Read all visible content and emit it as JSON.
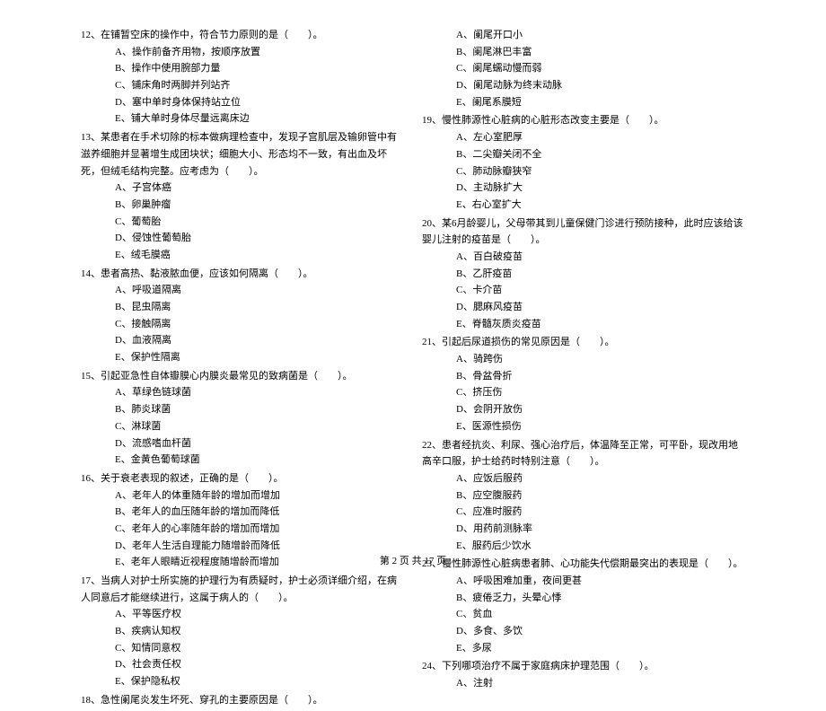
{
  "left": {
    "q12": {
      "title": "12、在铺暂空床的操作中，符合节力原则的是（　　）。",
      "a": "A、操作前备齐用物，按顺序放置",
      "b": "B、操作中使用腕部力量",
      "c": "C、铺床角时两脚并列站齐",
      "d": "D、塞中单时身体保持站立位",
      "e": "E、铺大单时身体尽量远离床边"
    },
    "q13": {
      "title": "13、某患者在手术切除的标本做病理检查中，发现子宫肌层及输卵管中有滋养细胞并显著增生成团块状；细胞大小、形态均不一致，有出血及坏死，但绒毛结构完整。应考虑为（　　）。",
      "a": "A、子宫体癌",
      "b": "B、卵巢肿瘤",
      "c": "C、葡萄胎",
      "d": "D、侵蚀性葡萄胎",
      "e": "E、绒毛膜癌"
    },
    "q14": {
      "title": "14、患者高热、黏液脓血便，应该如何隔离（　　）。",
      "a": "A、呼吸道隔离",
      "b": "B、昆虫隔离",
      "c": "C、接触隔离",
      "d": "D、血液隔离",
      "e": "E、保护性隔离"
    },
    "q15": {
      "title": "15、引起亚急性自体瓣膜心内膜炎最常见的致病菌是（　　）。",
      "a": "A、草绿色链球菌",
      "b": "B、肺炎球菌",
      "c": "C、淋球菌",
      "d": "D、流感嗜血杆菌",
      "e": "E、金黄色葡萄球菌"
    },
    "q16": {
      "title": "16、关于衰老表现的叙述，正确的是（　　）。",
      "a": "A、老年人的体重随年龄的增加而增加",
      "b": "B、老年人的血压随年龄的增加而降低",
      "c": "C、老年人的心率随年龄的增加而增加",
      "d": "D、老年人生活自理能力随增龄而降低",
      "e": "E、老年人眼睛近视程度随增龄而增加"
    },
    "q17": {
      "title": "17、当病人对护士所实施的护理行为有质疑时，护士必须详细介绍，在病人同意后才能继续进行，这属于病人的（　　）。",
      "a": "A、平等医疗权",
      "b": "B、疾病认知权",
      "c": "C、知情同意权",
      "d": "D、社会责任权",
      "e": "E、保护隐私权"
    },
    "q18": {
      "title": "18、急性阑尾炎发生坏死、穿孔的主要原因是（　　）。"
    }
  },
  "right": {
    "q18opts": {
      "a": "A、阑尾开口小",
      "b": "B、阑尾淋巴丰富",
      "c": "C、阑尾蠕动慢而弱",
      "d": "D、阑尾动脉为终末动脉",
      "e": "E、阑尾系膜短"
    },
    "q19": {
      "title": "19、慢性肺源性心脏病的心脏形态改变主要是（　　）。",
      "a": "A、左心室肥厚",
      "b": "B、二尖瓣关闭不全",
      "c": "C、肺动脉瓣狭窄",
      "d": "D、主动脉扩大",
      "e": "E、右心室扩大"
    },
    "q20": {
      "title": "20、某6月龄婴儿，父母带其到儿童保健门诊进行预防接种，此时应该给该婴儿注射的疫苗是（　　）。",
      "a": "A、百白破疫苗",
      "b": "B、乙肝疫苗",
      "c": "C、卡介苗",
      "d": "D、腮麻风疫苗",
      "e": "E、脊髓灰质炎疫苗"
    },
    "q21": {
      "title": "21、引起后尿道损伤的常见原因是（　　）。",
      "a": "A、骑跨伤",
      "b": "B、骨盆骨折",
      "c": "C、挤压伤",
      "d": "D、会阴开放伤",
      "e": "E、医源性损伤"
    },
    "q22": {
      "title": "22、患者经抗炎、利尿、强心治疗后，体温降至正常，可平卧，现改用地高辛口服，护士给药时特别注意（　　）。",
      "a": "A、应饭后服药",
      "b": "B、应空腹服药",
      "c": "C、应准时服药",
      "d": "D、用药前测脉率",
      "e": "E、服药后少饮水"
    },
    "q23": {
      "title": "23、慢性肺源性心脏病患者肺、心功能失代偿期最突出的表现是（　　）。",
      "a": "A、呼吸困难加重，夜间更甚",
      "b": "B、疲倦乏力，头晕心悸",
      "c": "C、贫血",
      "d": "D、多食、多饮",
      "e": "E、多尿"
    },
    "q24": {
      "title": "24、下列哪项治疗不属于家庭病床护理范围（　　）。",
      "a": "A、注射"
    }
  },
  "footer": "第 2 页 共 17 页"
}
